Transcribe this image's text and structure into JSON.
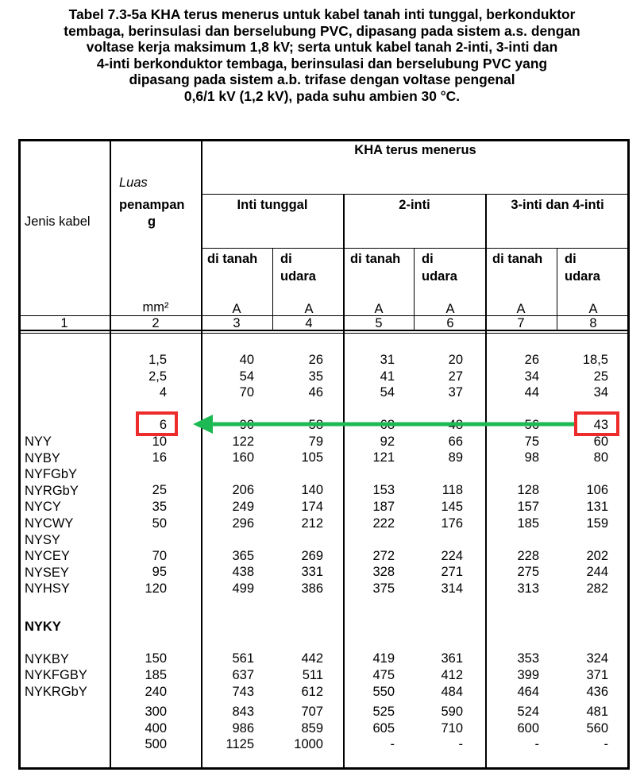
{
  "caption": [
    "Tabel  7.3-5a KHA terus menerus untuk kabel tanah inti tunggal, berkonduktor",
    "tembaga, berinsulasi dan berselubung PVC, dipasang pada sistem a.s. dengan",
    "voltase kerja maksimum 1,8 kV; serta untuk kabel tanah 2-inti, 3-inti  dan",
    "4-inti berkonduktor tembaga, berinsulasi dan berselubung PVC yang",
    "dipasang pada sistem a.b. trifase dengan voltase pengenal",
    "0,6/1 kV (1,2 kV), pada suhu ambien 30 °C."
  ],
  "header": {
    "jenis_kabel": "Jenis kabel",
    "luas": "Luas",
    "penampang_1": "penampan",
    "penampang_2": "g",
    "kha": "KHA terus menerus",
    "inti_tunggal": "Inti tunggal",
    "dua_inti": "2-inti",
    "tiga_empat_inti": "3-inti dan 4-inti",
    "di_tanah": "di tanah",
    "di": "di",
    "udara": "udara",
    "unit_mm2": "mm²",
    "unit_a": "A",
    "col_numbers": [
      "1",
      "2",
      "3",
      "4",
      "5",
      "6",
      "7",
      "8"
    ]
  },
  "cable_types": [
    "NYY",
    "NYBY",
    "NYFGbY",
    "NYRGbY",
    "NYCY",
    "NYCWY",
    "NYSY",
    "NYCEY",
    "NYSEY",
    "NYHSY",
    "",
    "NYKY",
    "",
    "NYKBY",
    "NYKFGBY",
    "NYKRGbY"
  ],
  "groups": [
    {
      "rows": [
        [
          "1,5",
          "40",
          "26",
          "31",
          "20",
          "26",
          "18,5"
        ],
        [
          "2,5",
          "54",
          "35",
          "41",
          "27",
          "34",
          "25"
        ],
        [
          "4",
          "70",
          "46",
          "54",
          "37",
          "44",
          "34"
        ]
      ]
    },
    {
      "rows": [
        [
          "6",
          "90",
          "58",
          "68",
          "48",
          "56",
          "43"
        ],
        [
          "10",
          "122",
          "79",
          "92",
          "66",
          "75",
          "60"
        ],
        [
          "16",
          "160",
          "105",
          "121",
          "89",
          "98",
          "80"
        ],
        [
          "",
          "",
          "",
          "",
          "",
          "",
          ""
        ],
        [
          "25",
          "206",
          "140",
          "153",
          "118",
          "128",
          "106"
        ],
        [
          "35",
          "249",
          "174",
          "187",
          "145",
          "157",
          "131"
        ],
        [
          "50",
          "296",
          "212",
          "222",
          "176",
          "185",
          "159"
        ],
        [
          "",
          "",
          "",
          "",
          "",
          "",
          ""
        ],
        [
          "70",
          "365",
          "269",
          "272",
          "224",
          "228",
          "202"
        ],
        [
          "95",
          "438",
          "331",
          "328",
          "271",
          "275",
          "244"
        ],
        [
          "120",
          "499",
          "386",
          "375",
          "314",
          "313",
          "282"
        ],
        [
          "",
          "",
          "",
          "",
          "",
          "",
          ""
        ],
        [
          "",
          "",
          "",
          "",
          "",
          "",
          ""
        ],
        [
          "",
          "",
          "",
          "",
          "",
          "",
          ""
        ],
        [
          "150",
          "561",
          "442",
          "419",
          "361",
          "353",
          "324"
        ],
        [
          "185",
          "637",
          "511",
          "475",
          "412",
          "399",
          "371"
        ],
        [
          "240",
          "743",
          "612",
          "550",
          "484",
          "464",
          "436"
        ]
      ]
    },
    {
      "rows": [
        [
          "300",
          "843",
          "707",
          "525",
          "590",
          "524",
          "481"
        ],
        [
          "400",
          "986",
          "859",
          "605",
          "710",
          "600",
          "560"
        ],
        [
          "500",
          "1125",
          "1000",
          "-",
          "-",
          "-",
          "-"
        ]
      ]
    }
  ],
  "annotation": {
    "highlight_left": "6",
    "highlight_right": "43",
    "box_color": "#ee2b2b",
    "arrow_color": "#1db954"
  }
}
